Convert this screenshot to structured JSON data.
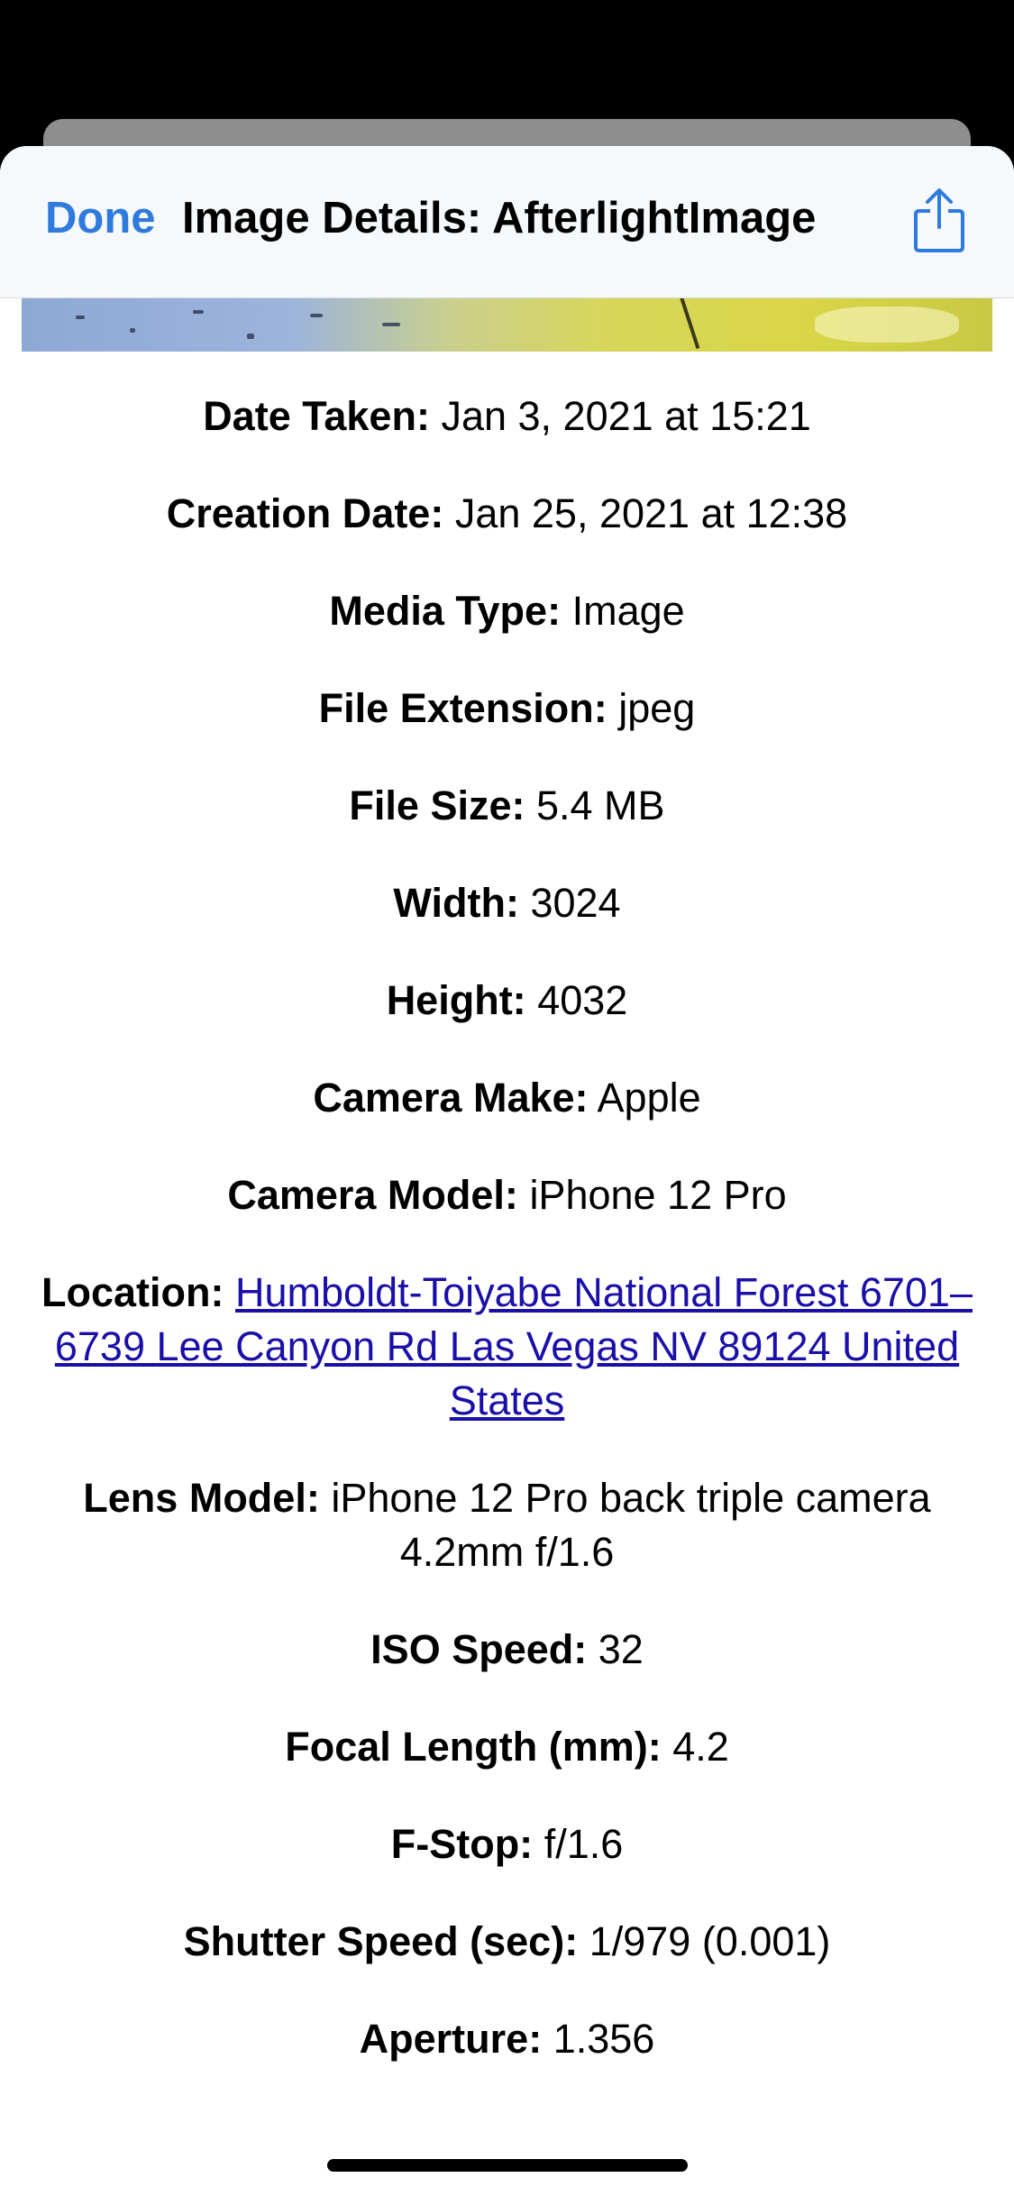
{
  "navbar": {
    "done_label": "Done",
    "title": "Image Details: AfterlightImage",
    "share_icon": "share-icon",
    "accent_color": "#2f7bdd"
  },
  "details": [
    {
      "label": "Date Taken:",
      "value": "Jan 3, 2021 at 15:21"
    },
    {
      "label": "Creation Date:",
      "value": "Jan 25, 2021 at 12:38"
    },
    {
      "label": "Media Type:",
      "value": "Image"
    },
    {
      "label": "File Extension:",
      "value": "jpeg"
    },
    {
      "label": "File Size:",
      "value": "5.4 MB"
    },
    {
      "label": "Width:",
      "value": "3024"
    },
    {
      "label": "Height:",
      "value": "4032"
    },
    {
      "label": "Camera Make:",
      "value": "Apple"
    },
    {
      "label": "Camera Model:",
      "value": "iPhone 12 Pro"
    },
    {
      "label": "Location:",
      "value": "Humboldt-Toiyabe National Forest 6701–6739 Lee Canyon Rd Las Vegas NV 89124 United States",
      "is_link": true
    },
    {
      "label": "Lens Model:",
      "value": "iPhone 12 Pro back triple camera 4.2mm f/1.6"
    },
    {
      "label": "ISO Speed:",
      "value": "32"
    },
    {
      "label": "Focal Length (mm):",
      "value": "4.2"
    },
    {
      "label": "F-Stop:",
      "value": "f/1.6"
    },
    {
      "label": "Shutter Speed (sec):",
      "value": "1/979 (0.001)"
    },
    {
      "label": "Aperture:",
      "value": "1.356"
    }
  ],
  "link_color": "#1a0fa8"
}
